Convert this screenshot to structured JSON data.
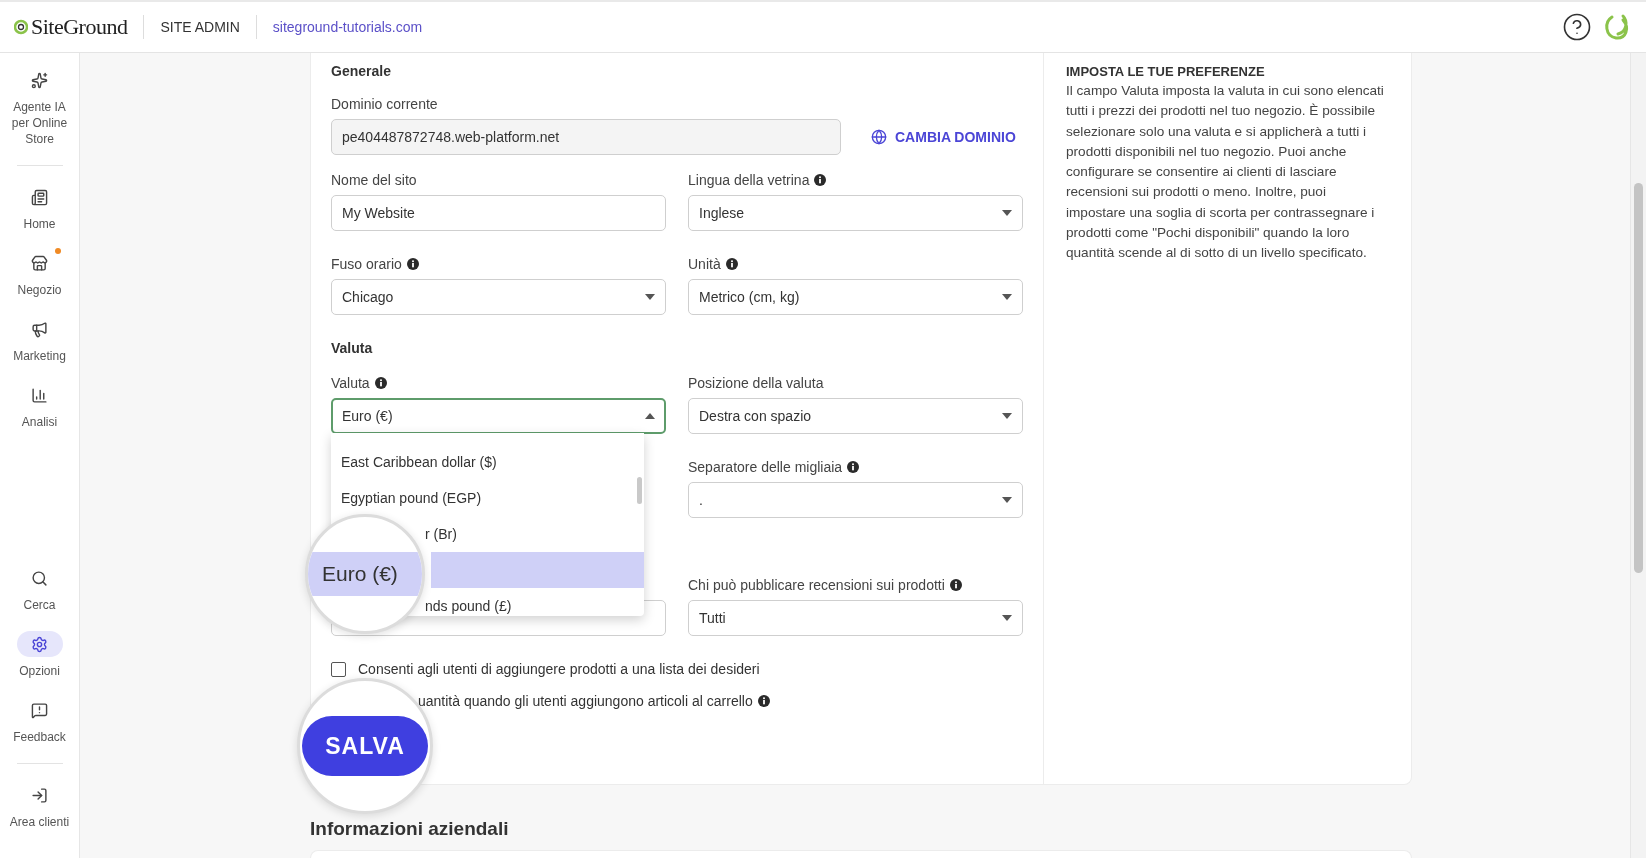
{
  "topbar": {
    "logo": "SiteGround",
    "section": "SITE ADMIN",
    "site_link": "siteground-tutorials.com"
  },
  "sidebar": {
    "top_items": [
      {
        "label": "Agente IA per Online Store",
        "selected": false,
        "notification": false
      },
      {
        "label": "Home",
        "selected": false,
        "notification": false
      },
      {
        "label": "Negozio",
        "selected": false,
        "notification": true
      },
      {
        "label": "Marketing",
        "selected": false,
        "notification": false
      },
      {
        "label": "Analisi",
        "selected": false,
        "notification": false
      }
    ],
    "bottom_items": [
      {
        "label": "Cerca",
        "selected": false,
        "notification": false
      },
      {
        "label": "Opzioni",
        "selected": true,
        "notification": false
      },
      {
        "label": "Feedback",
        "selected": false,
        "notification": false
      }
    ],
    "footer_items": [
      {
        "label": "Area clienti",
        "selected": false,
        "notification": false
      }
    ]
  },
  "general": {
    "heading": "Generale",
    "domain": {
      "label": "Dominio corrente",
      "value": "pe404487872748.web-platform.net",
      "action": "CAMBIA DOMINIO"
    },
    "site_name": {
      "label": "Nome del sito",
      "value": "My Website",
      "info": false
    },
    "language": {
      "label": "Lingua della vetrina",
      "value": "Inglese",
      "info": true
    },
    "timezone": {
      "label": "Fuso orario",
      "value": "Chicago",
      "info": true
    },
    "units": {
      "label": "Unità",
      "value": "Metrico (cm, kg)",
      "info": true
    }
  },
  "currency_section": {
    "heading": "Valuta",
    "currency": {
      "label": "Valuta",
      "value": "Euro (€)",
      "info": true,
      "expanded": true,
      "options": [
        {
          "label": "East Caribbean dollar ($)",
          "selected": false,
          "kind": "full"
        },
        {
          "label": "Egyptian pound (EGP)",
          "selected": false,
          "kind": "full"
        },
        {
          "label": "r (Br)",
          "selected": false,
          "kind": "partial"
        },
        {
          "label": "Euro (€)",
          "selected": true,
          "kind": "magnified"
        },
        {
          "label": "nds pound (£)",
          "selected": false,
          "kind": "partial"
        }
      ]
    },
    "position": {
      "label": "Posizione della valuta",
      "value": "Destra con spazio",
      "info": false
    },
    "thousands": {
      "label": "Separatore delle migliaia",
      "value": ".",
      "info": true
    },
    "reviews": {
      "label": "Chi può pubblicare recensioni sui prodotti",
      "value": "Tutti",
      "info": true
    }
  },
  "checkboxes": [
    {
      "label": "Consenti agli utenti di aggiungere prodotti a una lista dei desideri",
      "checked": false
    }
  ],
  "cart_note": {
    "text": "uantità quando gli utenti aggiungono articoli al carrello",
    "info": true
  },
  "save_button": "SALVA",
  "help_panel": {
    "title": "IMPOSTA LE TUE PREFERENZE",
    "text": "Il campo Valuta imposta la valuta in cui sono elencati tutti i prezzi dei prodotti nel tuo negozio. È possibile selezionare solo una valuta e si applicherà a tutti i prodotti disponibili nel tuo negozio. Puoi anche configurare se consentire ai clienti di lasciare recensioni sui prodotti o meno. Inoltre, puoi impostare una soglia di scorta per contrassegnare i prodotti come \"Pochi disponibili\" quando la loro quantità scende al di sotto di un livello specificato."
  },
  "next_section": {
    "heading": "Informazioni aziendali"
  }
}
